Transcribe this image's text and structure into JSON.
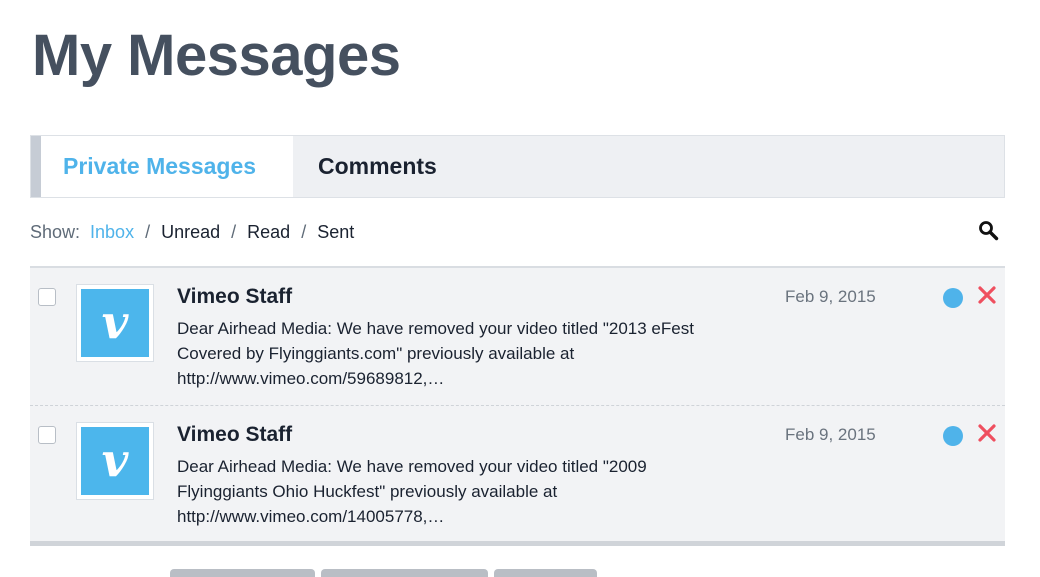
{
  "page": {
    "title": "My Messages"
  },
  "tabs": [
    {
      "label": "Private Messages",
      "active": true
    },
    {
      "label": "Comments",
      "active": false
    }
  ],
  "filter": {
    "label": "Show:",
    "options": [
      "Inbox",
      "Unread",
      "Read",
      "Sent"
    ],
    "active": "Inbox",
    "separator": "/"
  },
  "messages": [
    {
      "sender": "Vimeo Staff",
      "date": "Feb 9, 2015",
      "preview_lines": [
        "Dear Airhead Media: We have removed your video titled \"2013 eFest",
        "Covered by Flyinggiants.com\" previously available at",
        "http://www.vimeo.com/59689812,…"
      ],
      "avatar_icon": "vimeo-logo-icon",
      "unread": true
    },
    {
      "sender": "Vimeo Staff",
      "date": "Feb 9, 2015",
      "preview_lines": [
        "Dear Airhead Media: We have removed your video titled \"2009",
        "Flyinggiants Ohio Huckfest\" previously available at",
        "http://www.vimeo.com/14005778,…"
      ],
      "avatar_icon": "vimeo-logo-icon",
      "unread": true
    }
  ],
  "colors": {
    "accent": "#4fb3ea",
    "delete": "#ef4f5f",
    "title": "#45505f",
    "avatar_bg": "#4cb6ec"
  },
  "icons": {
    "search": "search-icon",
    "delete": "close-icon",
    "unread": "unread-dot-icon"
  }
}
